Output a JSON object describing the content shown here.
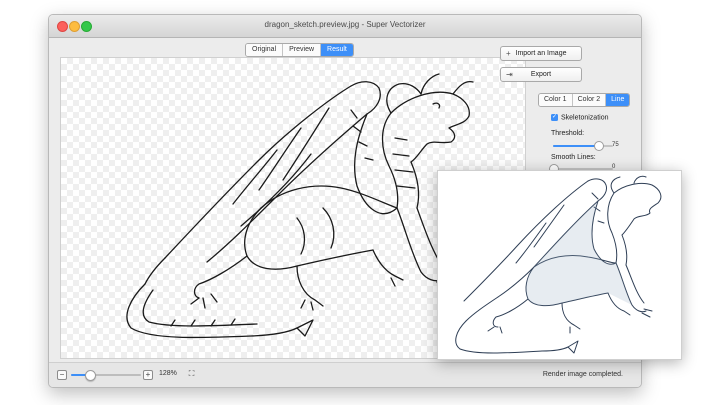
{
  "window": {
    "title": "dragon_sketch.preview.jpg - Super Vectorizer"
  },
  "view_tabs": [
    {
      "label": "Original",
      "active": false
    },
    {
      "label": "Preview",
      "active": false
    },
    {
      "label": "Result",
      "active": true
    }
  ],
  "sidebar": {
    "import_label": "Import an Image",
    "export_label": "Export",
    "mode_tabs": [
      {
        "label": "Color 1",
        "active": false
      },
      {
        "label": "Color 2",
        "active": false
      },
      {
        "label": "Line",
        "active": true
      }
    ],
    "skeletonization_label": "Skeletonization",
    "skeletonization_checked": true,
    "threshold_label": "Threshold:",
    "threshold_value": "75",
    "threshold_fraction": 0.75,
    "smooth_label": "Smooth Lines:",
    "smooth_value": "0",
    "smooth_fraction": 0
  },
  "bottom_bar": {
    "zoom_out_symbol": "−",
    "zoom_in_symbol": "+",
    "zoom_level": "128%",
    "zoom_fraction": 0.25,
    "fit_symbol": "⛶",
    "status": "Render image completed."
  },
  "icons": {
    "import": "import-icon",
    "export": "export-icon",
    "fit": "fit-to-window-icon"
  },
  "colors": {
    "accent": "#3d8ff8",
    "close": "#fc605c",
    "minimize": "#fdbc40",
    "maximize": "#34c84a"
  }
}
